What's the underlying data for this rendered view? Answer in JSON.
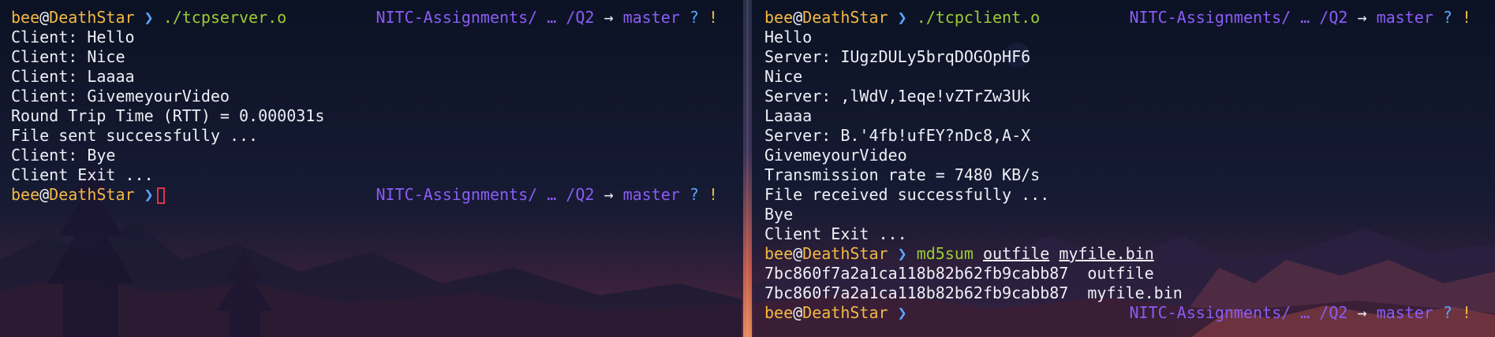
{
  "colors": {
    "background": "#0d1426",
    "text": "#eef0f6",
    "user_host": "#f4b942",
    "prompt_arrow": "#58a6ff",
    "command": "#9acd32",
    "path_branch": "#8b5cf6",
    "cursor": "#e0344a"
  },
  "prompt": {
    "user": "bee",
    "at": "@",
    "host": "DeathStar",
    "arrow": "❯",
    "path": "NITC-Assignments/ … /Q2",
    "right_arrow": "→",
    "branch": "master",
    "status_q": "?",
    "status_bang": "!"
  },
  "left_pane": {
    "command": "./tcpserver.o",
    "output": [
      "Client: Hello",
      "Client: Nice",
      "Client: Laaaa",
      "Client: GivemeyourVideo",
      "Round Trip Time (RTT) = 0.000031s",
      "File sent successfully ...",
      "Client: Bye",
      "Client Exit ..."
    ]
  },
  "right_pane": {
    "command": "./tcpclient.o",
    "output": [
      "Hello",
      "Server: IUgzDULy5brqDOGOpHF6",
      "Nice",
      "Server: ,lWdV,1eqe!vZTrZw3Uk",
      "Laaaa",
      "Server: B.'4fb!ufEY?nDc8,A-X",
      "GivemeyourVideo",
      "Transmission rate = 7480 KB/s",
      "File received successfully ...",
      "Bye",
      "Client Exit ..."
    ],
    "command2": {
      "program": "md5sum",
      "arg1": "outfile",
      "arg2": "myfile.bin"
    },
    "output2": [
      "7bc860f7a2a1ca118b82b62fb9cabb87  outfile",
      "7bc860f7a2a1ca118b82b62fb9cabb87  myfile.bin"
    ]
  }
}
